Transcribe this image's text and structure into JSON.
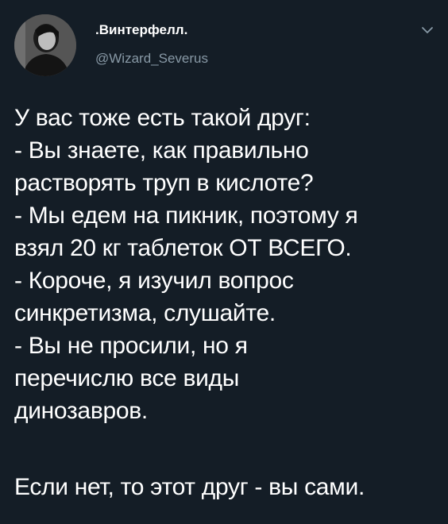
{
  "tweet": {
    "author": {
      "display_name": ".Винтерфелл.",
      "handle": "@Wizard_Severus",
      "avatar_icon": "user-avatar"
    },
    "menu_icon": "chevron-down-icon",
    "body_lines": [
      "У вас тоже есть такой друг:",
      "- Вы знаете, как правильно",
      "растворять труп в кислоте?",
      "- Мы едем на пикник, поэтому я",
      "взял 20 кг таблеток ОТ ВСЕГО.",
      "- Короче, я изучил вопрос",
      "синкретизма, слушайте.",
      "- Вы не просили, но я",
      "перечислю все виды",
      "динозавров."
    ],
    "closing_line": "Если нет, то этот друг - вы сами."
  },
  "colors": {
    "background": "#141d26",
    "text": "#ffffff",
    "secondary_text": "#8899a6"
  }
}
